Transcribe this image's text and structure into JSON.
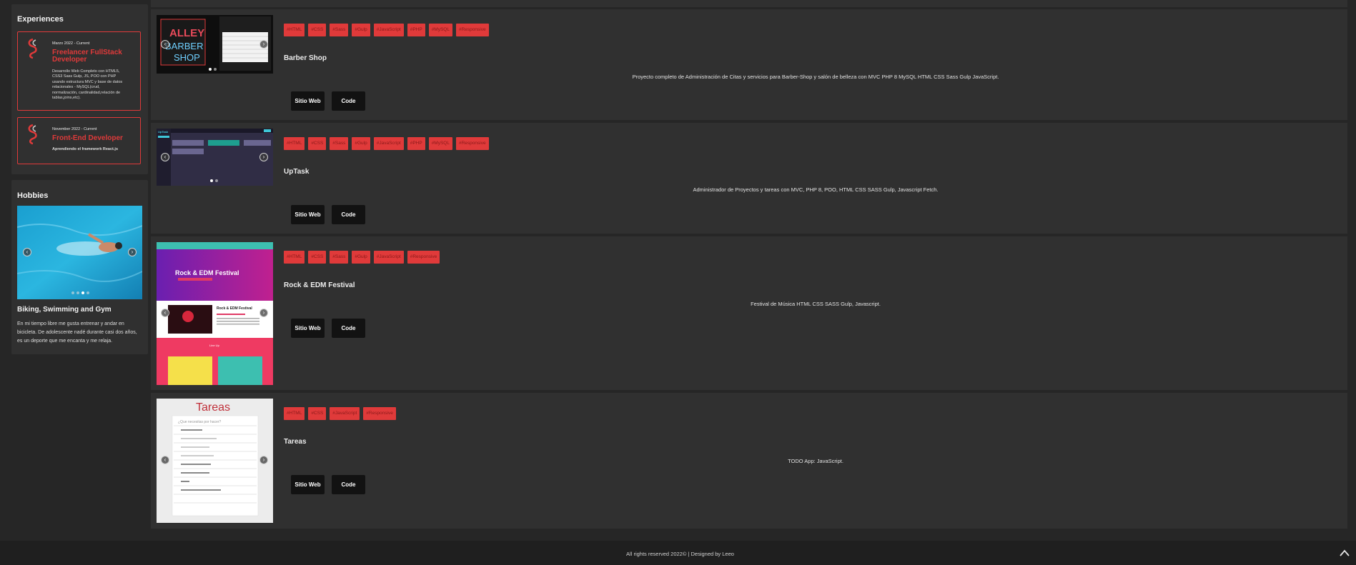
{
  "experiences": {
    "heading": "Experiences",
    "items": [
      {
        "date": "Marzo 2022 - Current",
        "title_l1": "Freelancer FullStack",
        "title_l2": "Developer",
        "desc_lines": [
          "Desarrollo Web Completo con HTML5,",
          "CSS3 Sass Gulp, JS, POO con PHP",
          "usando estructura MVC y base de datos",
          "relacionales - MySQL(crud,",
          "normalización, cardinalidad,relación de",
          "tablas,joins,etc)."
        ]
      },
      {
        "date": "November 2022 - Current",
        "title_l1": "Front-End Developer",
        "title_l2": "",
        "desc_lines": [
          "Aprendiendo el framework React.js"
        ]
      }
    ]
  },
  "hobbies": {
    "heading": "Hobbies",
    "title": "Biking, Swimming and Gym",
    "text": "En mi tiempo libre me gusta entrenar y andar en bicicleta. De adolescente nadé durante casi dos años, es un deporte que me encanta y me relaja."
  },
  "projects": [
    {
      "title": "Barber Shop",
      "tags": [
        "#HTML",
        "#CSS",
        "#Sass",
        "#Gulp",
        "#JavaScript",
        "#PHP",
        "#MySQL",
        "#Responsive"
      ],
      "description": "Proyecto completo de Administración de Citas y servicios para Barber-Shop y salón de belleza con MVC PHP 8 MySQL HTML CSS Sass Gulp JavaScript.",
      "site_label": "Sitio Web",
      "code_label": "Code",
      "shot_text_l1": "ALLEY",
      "shot_text_l2": "BARBER",
      "shot_text_l3": "SHOP"
    },
    {
      "title": "UpTask",
      "tags": [
        "#HTML",
        "#CSS",
        "#Sass",
        "#Gulp",
        "#JavaScript",
        "#PHP",
        "#MySQL",
        "#Responsive"
      ],
      "description": "Administrador de Proyectos y tareas con MVC, PHP 8, POO, HTML CSS SASS Gulp, Javascript Fetch.",
      "site_label": "Sitio Web",
      "code_label": "Code",
      "shot_brand": "UpTask"
    },
    {
      "title": "Rock & EDM Festival",
      "tags": [
        "#HTML",
        "#CSS",
        "#Sass",
        "#Gulp",
        "#JavaScript",
        "#Responsive"
      ],
      "description": "Festival de Música HTML CSS SASS Gulp, Javascript.",
      "site_label": "Sitio Web",
      "code_label": "Code",
      "shot_hero": "Rock & EDM Festival",
      "shot_sub": "Rock & EDM Festival",
      "shot_lineup": "Line Up"
    },
    {
      "title": "Tareas",
      "tags": [
        "#HTML",
        "#CSS",
        "#JavaScript",
        "#Responsive"
      ],
      "description": "TODO App: JavaScript.",
      "site_label": "Sitio Web",
      "code_label": "Code",
      "shot_heading": "Tareas",
      "shot_input": "¿Que necesitas por hacer?"
    }
  ],
  "footer": {
    "text": "All rights reserved 2022© | Designed by Leeo"
  },
  "colors": {
    "accent": "#e03a3a",
    "panel": "#303030",
    "background": "#262626",
    "button": "#121212"
  }
}
